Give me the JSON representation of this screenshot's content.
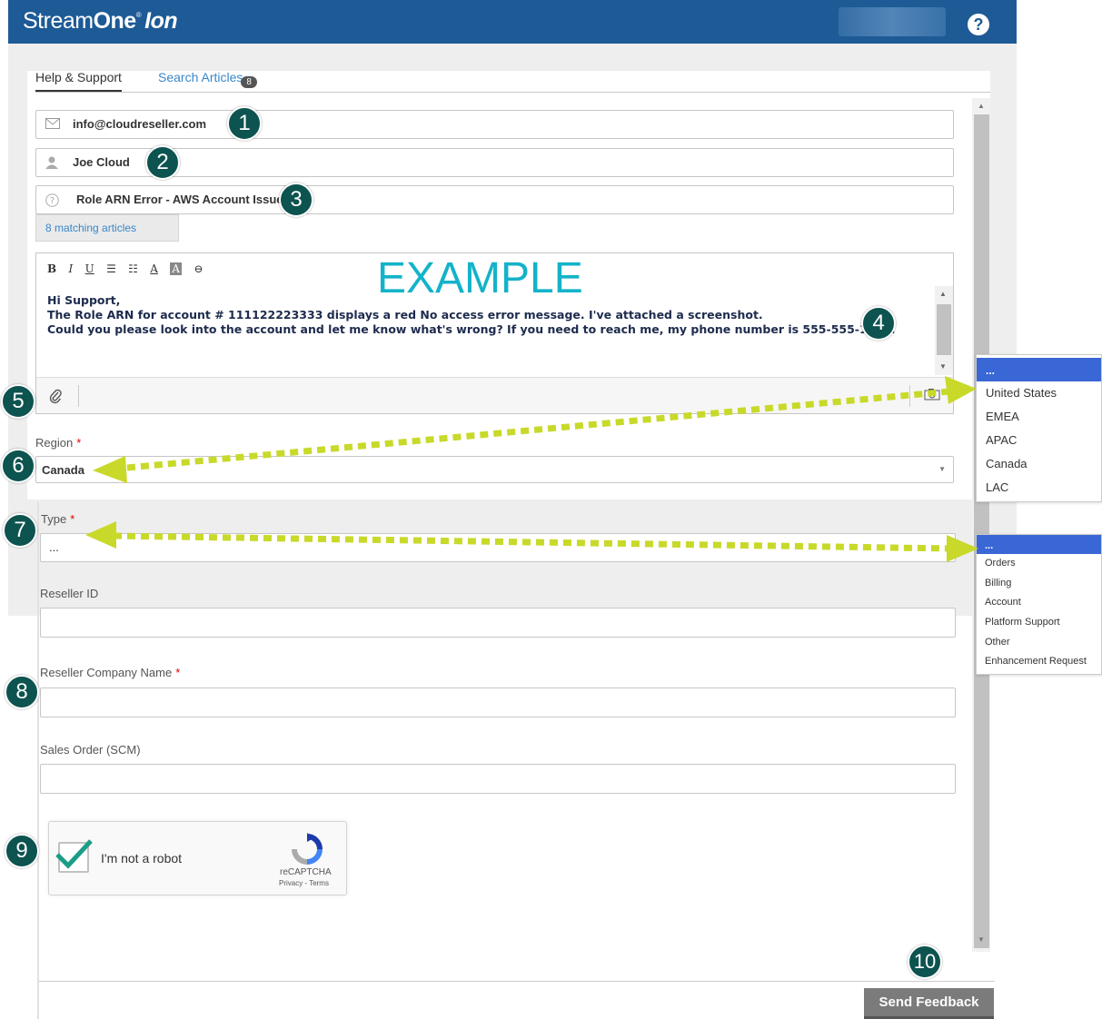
{
  "header": {
    "brand_part1": "Stream",
    "brand_part2": "One",
    "brand_reg": "®",
    "brand_part3": "Ion",
    "help_label": "?"
  },
  "tabs": [
    {
      "label": "Help & Support"
    },
    {
      "label": "Search Articles",
      "badge": "8"
    }
  ],
  "form": {
    "email": "info@cloudreseller.com",
    "name": "Joe Cloud",
    "subject": "Role ARN Error - AWS Account Issue",
    "matching_articles": "8 matching articles",
    "editor_toolbar": [
      "B",
      "I",
      "U",
      "☰",
      "☷",
      "A",
      "A",
      "⊖"
    ],
    "watermark": "EXAMPLE",
    "message_lines": [
      "Hi Support,",
      "The Role ARN for account # 111122223333 displays a red No access error message. I've attached a screenshot.",
      "Could you please look into the account and let me know what's wrong? If you need to reach me, my phone number is 555-555-1234."
    ],
    "region_label": "Region",
    "region_value": "Canada",
    "type_label": "Type",
    "type_value": "...",
    "reseller_id_label": "Reseller ID",
    "reseller_company_label": "Reseller Company Name",
    "sales_order_label": "Sales Order (SCM)"
  },
  "region_dropdown": {
    "options": [
      "...",
      "United States",
      "EMEA",
      "APAC",
      "Canada",
      "LAC"
    ],
    "selected_index": 0
  },
  "type_dropdown": {
    "options": [
      "...",
      "Orders",
      "Billing",
      "Account",
      "Platform Support",
      "Other",
      "Enhancement Request"
    ],
    "selected_index": 0
  },
  "captcha": {
    "label": "I'm not a robot",
    "brand": "reCAPTCHA",
    "links": "Privacy - Terms"
  },
  "send_button": "Send Feedback",
  "markers": [
    "1",
    "2",
    "3",
    "4",
    "5",
    "6",
    "7",
    "8",
    "9",
    "10"
  ],
  "colors": {
    "header_bg": "#1d5a96",
    "marker_bg": "#0d5350",
    "arrow": "#c8d92a",
    "watermark": "#13b3c9",
    "dropdown_selected": "#3a67d6"
  }
}
